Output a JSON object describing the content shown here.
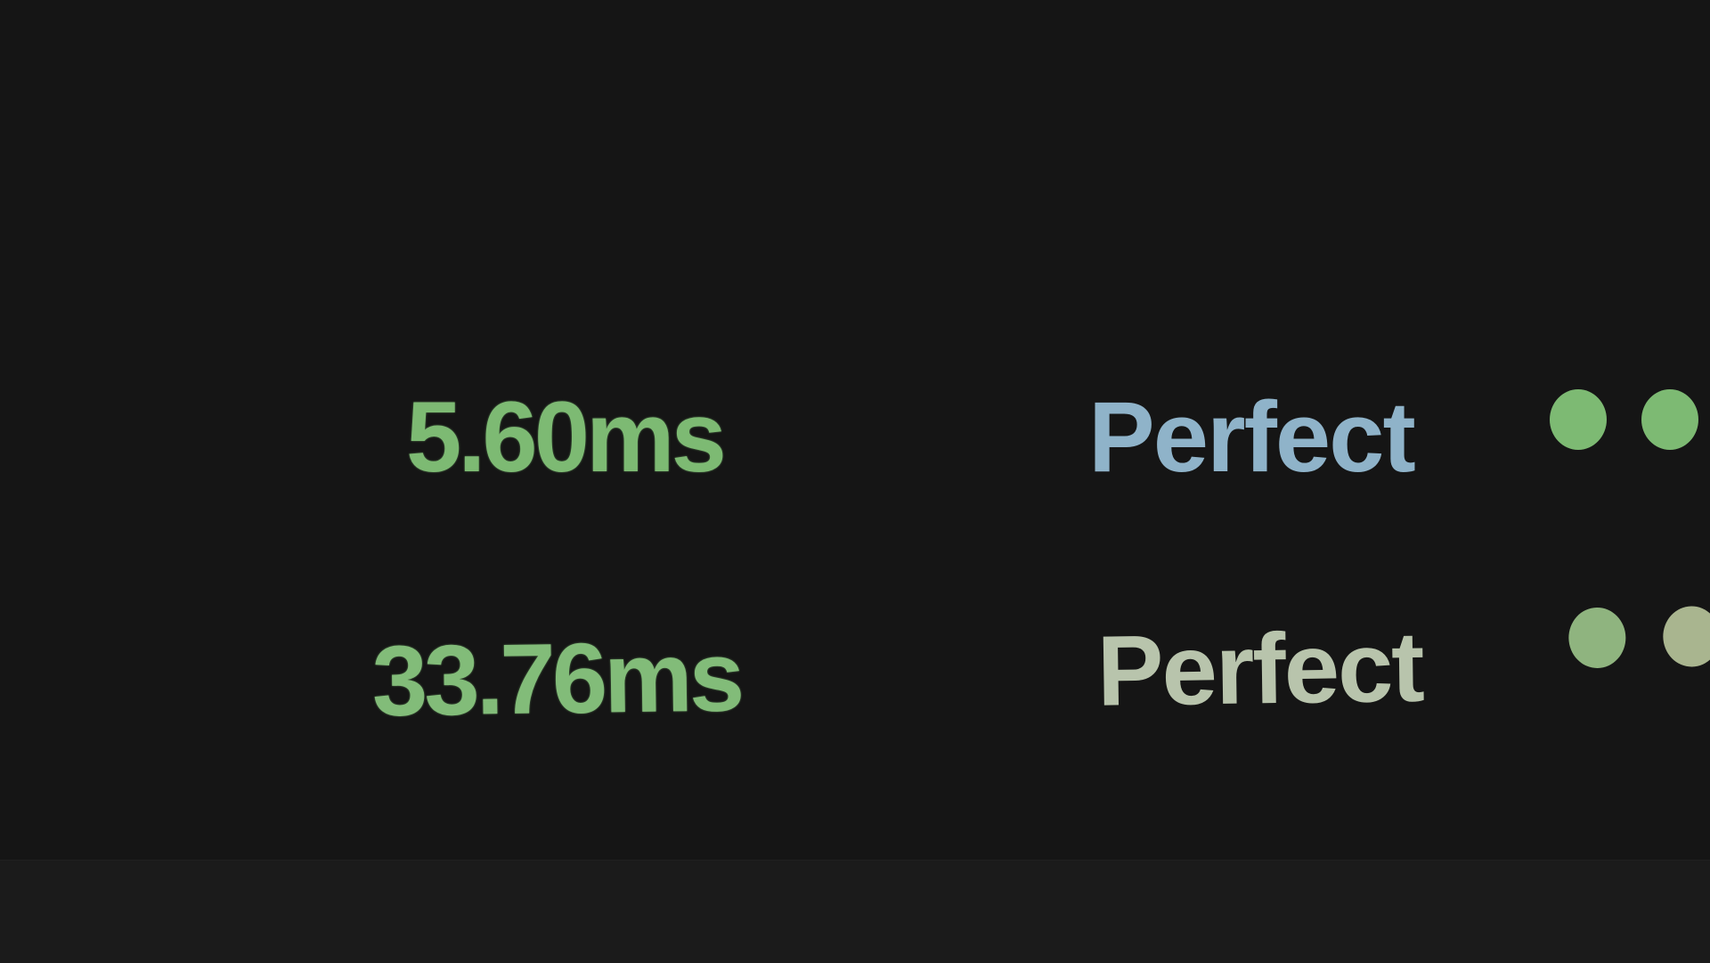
{
  "rows": [
    {
      "latency": "5.60ms",
      "rating": "Perfect",
      "indicators": [
        {
          "icon": "status-dot-icon",
          "color": "#7dba73"
        },
        {
          "icon": "status-dot-icon",
          "color": "#7dba73"
        }
      ]
    },
    {
      "latency": "33.76ms",
      "rating": "Perfect",
      "indicators": [
        {
          "icon": "status-dot-icon",
          "color": "#8fb47f"
        },
        {
          "icon": "status-dot-icon",
          "color": "#a9b58f"
        }
      ]
    }
  ],
  "colors": {
    "background": "#151515",
    "latency_text": "#7dba73",
    "rating_text_row1": "#8fb3c9",
    "rating_text_row2": "#b8c4ac"
  }
}
